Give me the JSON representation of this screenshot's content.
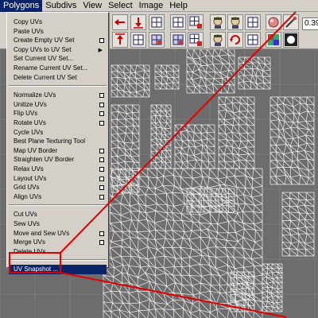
{
  "menubar": {
    "items": [
      "Polygons",
      "Subdivs",
      "View",
      "Select",
      "Image",
      "Help"
    ]
  },
  "toolbar": {
    "field_value": "0.39"
  },
  "menu": {
    "groups": [
      [
        "Copy UVs",
        "Paste UVs",
        "Create Empty UV Set",
        "Copy UVs to UV Set",
        "Set Current UV Set...",
        "Rename Current UV Set...",
        "Delete Current UV Set"
      ],
      [
        "Normalize UVs",
        "Unitize UVs",
        "Flip UVs",
        "Rotate UVs",
        "Cycle UVs",
        "Best Plane Texturing Tool",
        "Map UV Border",
        "Straighten UV Border",
        "Relax UVs",
        "Layout UVs",
        "Grid UVs",
        "Align UVs"
      ],
      [
        "Cut UVs",
        "Sew UVs",
        "Move and Sew UVs",
        "Merge UVs",
        "Delete UVs"
      ],
      [
        "UV Snapshot ..."
      ]
    ],
    "has_options": [
      [
        false,
        false,
        true,
        false,
        false,
        false,
        false
      ],
      [
        true,
        true,
        true,
        true,
        false,
        false,
        true,
        true,
        true,
        true,
        true,
        true
      ],
      [
        false,
        false,
        true,
        true,
        false
      ],
      [
        false
      ]
    ],
    "has_submenu": [
      [
        false,
        false,
        false,
        true,
        false,
        false,
        false
      ],
      [
        false,
        false,
        false,
        false,
        false,
        false,
        false,
        false,
        false,
        false,
        false,
        false
      ],
      [
        false,
        false,
        false,
        false,
        false
      ],
      [
        false
      ]
    ],
    "selected_item": "UV Snapshot ..."
  },
  "colors": {
    "menu_bg": "#d4d0c8",
    "highlight": "#0a246a",
    "viewport_bg": "#6d6d6d",
    "wireframe": "#f2f2f2",
    "annotation": "#e00000"
  }
}
